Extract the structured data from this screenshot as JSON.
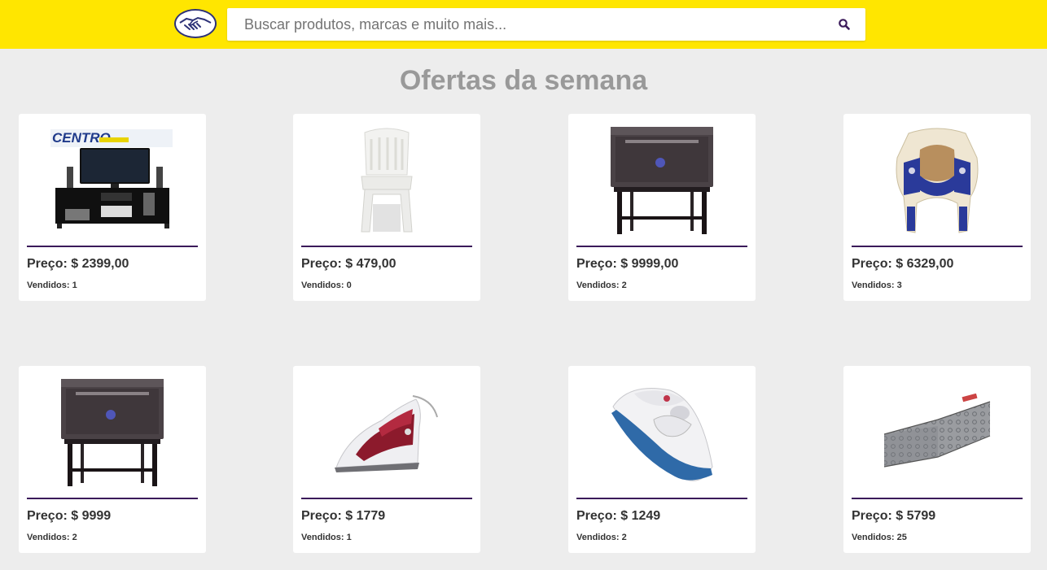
{
  "header": {
    "logo_icon": "handshake-logo-icon",
    "search": {
      "placeholder": "Buscar produtos, marcas e muito mais...",
      "value": "",
      "icon": "search-icon"
    },
    "brand_color": "#ffe600",
    "accent_color": "#3b1a5a"
  },
  "main": {
    "title": "Ofertas da semana",
    "products": [
      {
        "price": "Preço: $ 2399,00",
        "sold": "Vendidos: 1",
        "image": "tv-rack-image",
        "brand": "CENTRO"
      },
      {
        "price": "Preço: $ 479,00",
        "sold": "Vendidos: 0",
        "image": "plastic-chair-image"
      },
      {
        "price": "Preço: $ 9999,00",
        "sold": "Vendidos: 2",
        "image": "oven-stand-image"
      },
      {
        "price": "Preço: $ 6329,00",
        "sold": "Vendidos: 3",
        "image": "neck-massager-image"
      },
      {
        "price": "Preço: $ 9999",
        "sold": "Vendidos: 2",
        "image": "oven-stand-image"
      },
      {
        "price": "Preço: $ 1779",
        "sold": "Vendidos: 1",
        "image": "steam-iron-red-image"
      },
      {
        "price": "Preço: $ 1249",
        "sold": "Vendidos: 2",
        "image": "steam-iron-blue-image"
      },
      {
        "price": "Preço: $ 5799",
        "sold": "Vendidos: 25",
        "image": "mattress-image"
      }
    ]
  }
}
